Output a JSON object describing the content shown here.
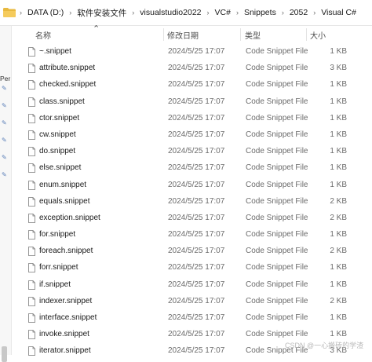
{
  "address_bar": {
    "crumbs": [
      "DATA (D:)",
      "软件安装文件",
      "visualstudio2022",
      "VC#",
      "Snippets",
      "2052",
      "Visual C#"
    ]
  },
  "nav": {
    "partial_label": "Per"
  },
  "columns": {
    "name": "名称",
    "date": "修改日期",
    "type": "类型",
    "size": "大小"
  },
  "files": [
    {
      "name": "~.snippet",
      "date": "2024/5/25 17:07",
      "type": "Code Snippet File",
      "size": "1 KB"
    },
    {
      "name": "attribute.snippet",
      "date": "2024/5/25 17:07",
      "type": "Code Snippet File",
      "size": "3 KB"
    },
    {
      "name": "checked.snippet",
      "date": "2024/5/25 17:07",
      "type": "Code Snippet File",
      "size": "1 KB"
    },
    {
      "name": "class.snippet",
      "date": "2024/5/25 17:07",
      "type": "Code Snippet File",
      "size": "1 KB"
    },
    {
      "name": "ctor.snippet",
      "date": "2024/5/25 17:07",
      "type": "Code Snippet File",
      "size": "1 KB"
    },
    {
      "name": "cw.snippet",
      "date": "2024/5/25 17:07",
      "type": "Code Snippet File",
      "size": "1 KB"
    },
    {
      "name": "do.snippet",
      "date": "2024/5/25 17:07",
      "type": "Code Snippet File",
      "size": "1 KB"
    },
    {
      "name": "else.snippet",
      "date": "2024/5/25 17:07",
      "type": "Code Snippet File",
      "size": "1 KB"
    },
    {
      "name": "enum.snippet",
      "date": "2024/5/25 17:07",
      "type": "Code Snippet File",
      "size": "1 KB"
    },
    {
      "name": "equals.snippet",
      "date": "2024/5/25 17:07",
      "type": "Code Snippet File",
      "size": "2 KB"
    },
    {
      "name": "exception.snippet",
      "date": "2024/5/25 17:07",
      "type": "Code Snippet File",
      "size": "2 KB"
    },
    {
      "name": "for.snippet",
      "date": "2024/5/25 17:07",
      "type": "Code Snippet File",
      "size": "1 KB"
    },
    {
      "name": "foreach.snippet",
      "date": "2024/5/25 17:07",
      "type": "Code Snippet File",
      "size": "2 KB"
    },
    {
      "name": "forr.snippet",
      "date": "2024/5/25 17:07",
      "type": "Code Snippet File",
      "size": "1 KB"
    },
    {
      "name": "if.snippet",
      "date": "2024/5/25 17:07",
      "type": "Code Snippet File",
      "size": "1 KB"
    },
    {
      "name": "indexer.snippet",
      "date": "2024/5/25 17:07",
      "type": "Code Snippet File",
      "size": "2 KB"
    },
    {
      "name": "interface.snippet",
      "date": "2024/5/25 17:07",
      "type": "Code Snippet File",
      "size": "1 KB"
    },
    {
      "name": "invoke.snippet",
      "date": "2024/5/25 17:07",
      "type": "Code Snippet File",
      "size": "1 KB"
    },
    {
      "name": "iterator.snippet",
      "date": "2024/5/25 17:07",
      "type": "Code Snippet File",
      "size": "3 KB"
    }
  ],
  "watermark": "CSDN @一心搬砖的学渣",
  "colors": {
    "folder": "#e8b93f",
    "header_text": "#4d4d4d",
    "secondary_text": "#6b6b6b"
  },
  "icons": {
    "folder": "folder-icon",
    "file": "file-icon",
    "sort": "sort-asc-icon",
    "pin": "pin-icon"
  }
}
